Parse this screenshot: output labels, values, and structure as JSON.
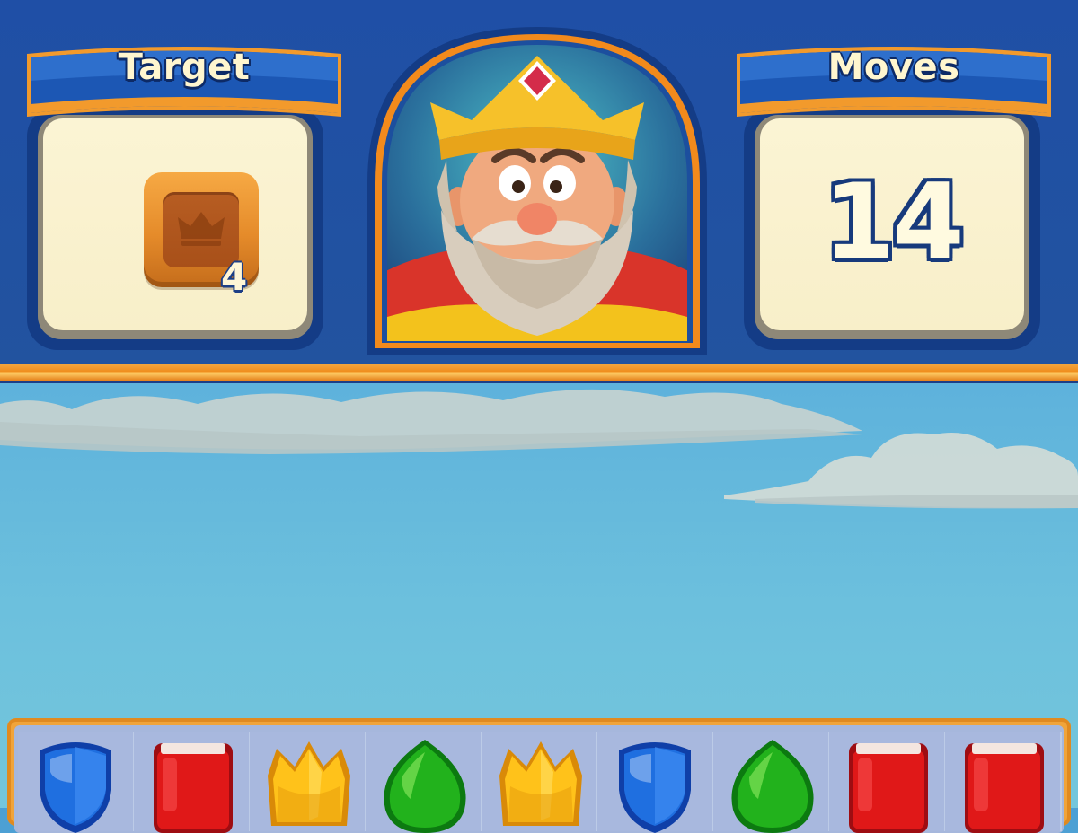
{
  "hud": {
    "target": {
      "label": "Target",
      "item_icon": "wooden-crown-box-icon",
      "count": "4"
    },
    "moves": {
      "label": "Moves",
      "value": "14"
    },
    "portrait": {
      "character": "king-portrait"
    }
  },
  "board": {
    "visible_row": [
      {
        "gem": "blue-shield",
        "color": "#1f6fe0"
      },
      {
        "gem": "red-book",
        "color": "#e01818"
      },
      {
        "gem": "yellow-crown",
        "color": "#ffc21a"
      },
      {
        "gem": "green-leaf",
        "color": "#22b21c"
      },
      {
        "gem": "yellow-crown",
        "color": "#ffc21a"
      },
      {
        "gem": "blue-shield",
        "color": "#1f6fe0"
      },
      {
        "gem": "green-leaf",
        "color": "#22b21c"
      },
      {
        "gem": "red-book",
        "color": "#e01818"
      },
      {
        "gem": "red-book",
        "color": "#e01818"
      }
    ]
  },
  "colors": {
    "hud_blue": "#22539f",
    "accent_orange": "#f08c1c",
    "panel_cream": "#f8efc9",
    "sky_top": "#4c9fd4",
    "sky_bottom": "#74c6dc"
  }
}
